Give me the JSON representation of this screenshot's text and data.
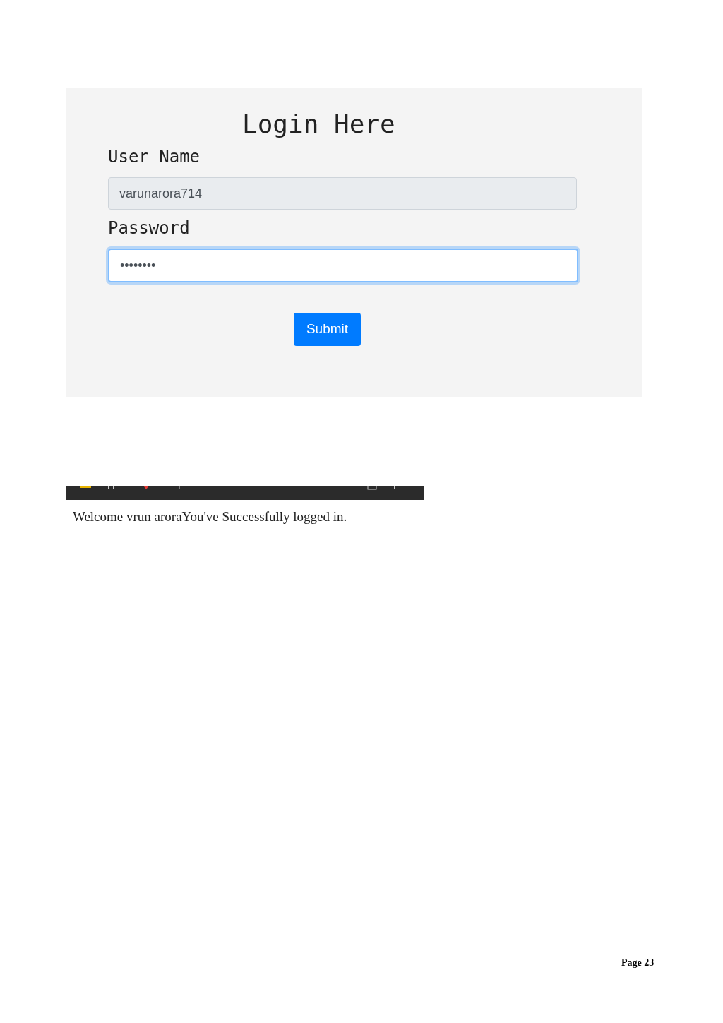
{
  "login_form": {
    "title": "Login Here",
    "fields": [
      {
        "label": "User Name",
        "value": "varunarora714",
        "focused": false
      },
      {
        "label": "Password",
        "value": "••••••••",
        "focused": true
      }
    ],
    "submit": "Submit"
  },
  "message": "Welcome vrun aroraYou've Successfully logged in.",
  "footer": {
    "page": "Page 23"
  }
}
